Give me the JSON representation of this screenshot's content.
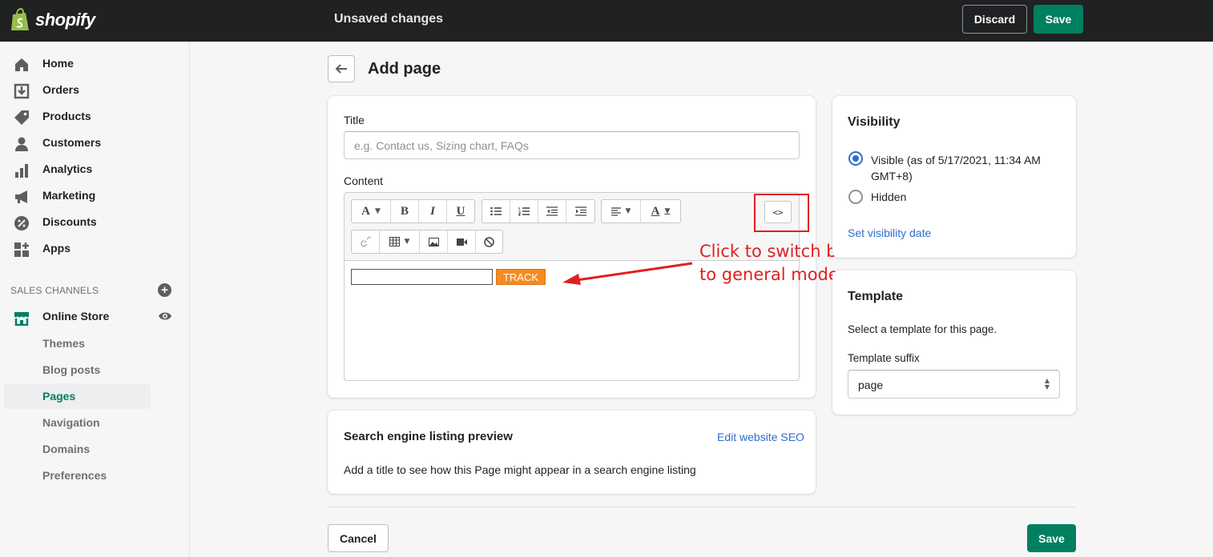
{
  "topbar": {
    "logo_text": "shopify",
    "status": "Unsaved changes",
    "discard_label": "Discard",
    "save_label": "Save"
  },
  "sidebar": {
    "items": [
      {
        "label": "Home",
        "icon": "home-icon"
      },
      {
        "label": "Orders",
        "icon": "orders-icon"
      },
      {
        "label": "Products",
        "icon": "tag-icon"
      },
      {
        "label": "Customers",
        "icon": "person-icon"
      },
      {
        "label": "Analytics",
        "icon": "bar-chart-icon"
      },
      {
        "label": "Marketing",
        "icon": "megaphone-icon"
      },
      {
        "label": "Discounts",
        "icon": "discount-icon"
      },
      {
        "label": "Apps",
        "icon": "apps-icon"
      }
    ],
    "section_header": "SALES CHANNELS",
    "channel": {
      "label": "Online Store",
      "icon": "store-icon"
    },
    "sub_items": [
      "Themes",
      "Blog posts",
      "Pages",
      "Navigation",
      "Domains",
      "Preferences"
    ],
    "active_sub_item": "Pages"
  },
  "page": {
    "title": "Add page"
  },
  "main_card": {
    "title_label": "Title",
    "title_placeholder": "e.g. Contact us, Sizing chart, FAQs",
    "title_value": "",
    "content_label": "Content",
    "embed_button_label": "TRACK",
    "code_toggle_label": "<>"
  },
  "annotation": {
    "line1": "Click to switch back",
    "line2": "to general mode",
    "color": "#e02020"
  },
  "seo_card": {
    "title": "Search engine listing preview",
    "edit_link": "Edit website SEO",
    "description": "Add a title to see how this Page might appear in a search engine listing"
  },
  "visibility_card": {
    "title": "Visibility",
    "visible_line1": "Visible (as of 5/17/2021, 11:34 AM",
    "visible_line2": "GMT+8)",
    "hidden_label": "Hidden",
    "selected": "Visible",
    "set_date_link": "Set visibility date"
  },
  "template_card": {
    "title": "Template",
    "description": "Select a template for this page.",
    "suffix_label": "Template suffix",
    "suffix_value": "page"
  },
  "footer": {
    "cancel_label": "Cancel",
    "save_label": "Save"
  },
  "colors": {
    "brand_green": "#008060",
    "link_blue": "#2c6ecb",
    "topbar": "#202123",
    "embed_button": "#f68b1f"
  }
}
